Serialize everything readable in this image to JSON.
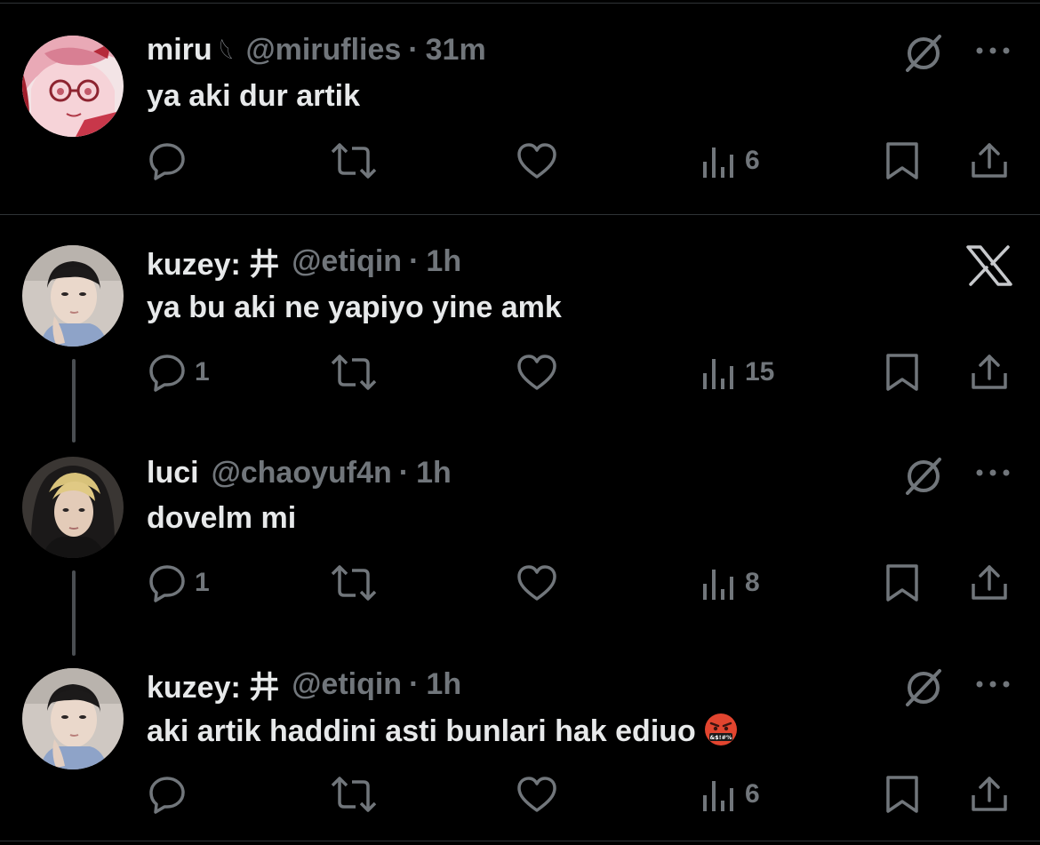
{
  "colors": {
    "background": "#000000",
    "text": "#e7e9ea",
    "muted": "#71767b",
    "divider": "#2f3336"
  },
  "tweets": [
    {
      "name": "miru",
      "name_deco": "𓆩",
      "handle": "@miruflies",
      "separator": "·",
      "time": "31m",
      "text": "ya aki dur artik",
      "reply_count": "",
      "retweet_count": "",
      "like_count": "",
      "views": "6",
      "top_icon": "grok-icon"
    },
    {
      "name": "kuzey: 井",
      "handle": "@etiqin",
      "separator": "·",
      "time": "1h",
      "text": "ya bu aki ne yapiyo yine amk",
      "reply_count": "1",
      "retweet_count": "",
      "like_count": "",
      "views": "15",
      "top_icon": "x-logo-icon"
    },
    {
      "name": "luci",
      "handle": "@chaoyuf4n",
      "separator": "·",
      "time": "1h",
      "text": "dovelm mi",
      "reply_count": "1",
      "retweet_count": "",
      "like_count": "",
      "views": "8",
      "top_icon": "grok-icon"
    },
    {
      "name": "kuzey: 井",
      "handle": "@etiqin",
      "separator": "·",
      "time": "1h",
      "text": "aki artik haddini asti bunlari hak ediuo",
      "emoji": "swearing-face-emoji",
      "reply_count": "",
      "retweet_count": "",
      "like_count": "",
      "views": "6",
      "top_icon": "grok-icon"
    }
  ]
}
